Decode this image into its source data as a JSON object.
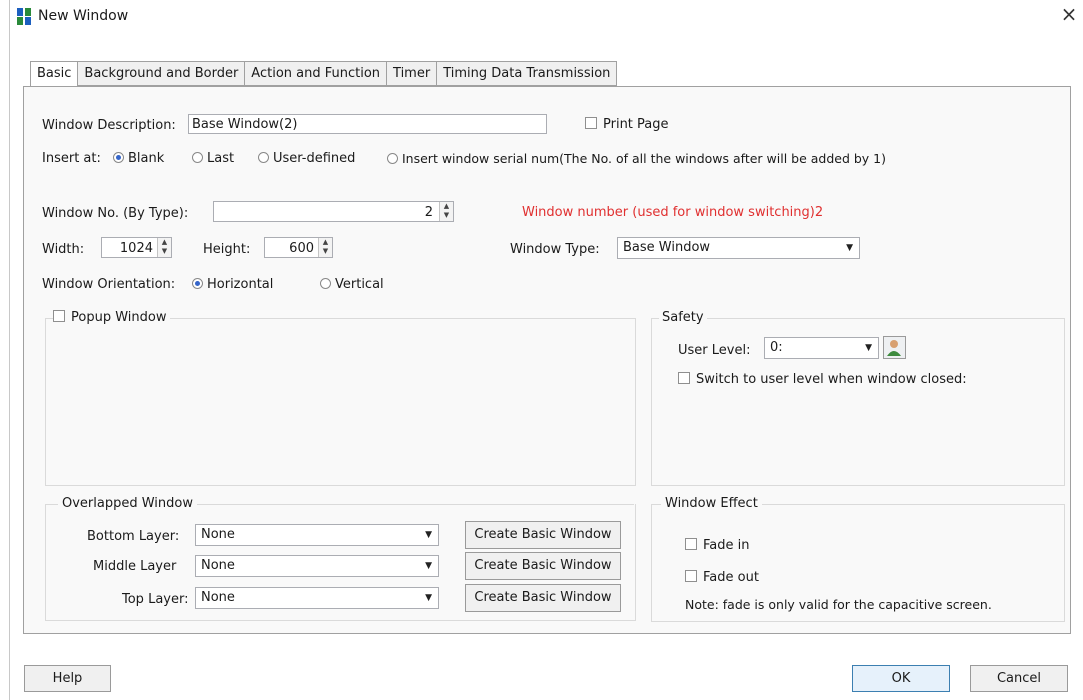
{
  "window": {
    "title": "New Window"
  },
  "tabs": [
    "Basic",
    "Background and Border",
    "Action and Function",
    "Timer",
    "Timing Data Transmission"
  ],
  "basic": {
    "description_label": "Window Description:",
    "description_value": "Base Window(2)",
    "print_page_label": "Print Page",
    "insert_label": "Insert at:",
    "insert_options": [
      "Blank",
      "Last",
      "User-defined",
      "Insert window serial num(The No. of all the windows after will be added by 1)"
    ],
    "window_no_label": "Window No. (By Type):",
    "window_no_value": "2",
    "window_no_note": "Window number (used for window switching)2",
    "width_label": "Width:",
    "width_value": "1024",
    "height_label": "Height:",
    "height_value": "600",
    "window_type_label": "Window Type:",
    "window_type_value": "Base Window",
    "orientation_label": "Window Orientation:",
    "orientation_options": [
      "Horizontal",
      "Vertical"
    ],
    "popup_label": "Popup Window",
    "safety_title": "Safety",
    "user_level_label": "User Level:",
    "user_level_value": "0:",
    "switch_label": "Switch to user level when window closed:",
    "overlapped_title": "Overlapped Window",
    "layers": [
      {
        "label": "Bottom Layer:",
        "value": "None",
        "button": "Create Basic Window"
      },
      {
        "label": "Middle Layer",
        "value": "None",
        "button": "Create Basic Window"
      },
      {
        "label": "Top Layer:",
        "value": "None",
        "button": "Create Basic Window"
      }
    ],
    "effect_title": "Window Effect",
    "fade_in_label": "Fade in",
    "fade_out_label": "Fade out",
    "fade_note": "Note: fade is only valid for the capacitive screen."
  },
  "footer": {
    "help": "Help",
    "ok": "OK",
    "cancel": "Cancel"
  },
  "colors": {
    "accent_red": "#e03030",
    "radio_selected": "#3565c9"
  }
}
